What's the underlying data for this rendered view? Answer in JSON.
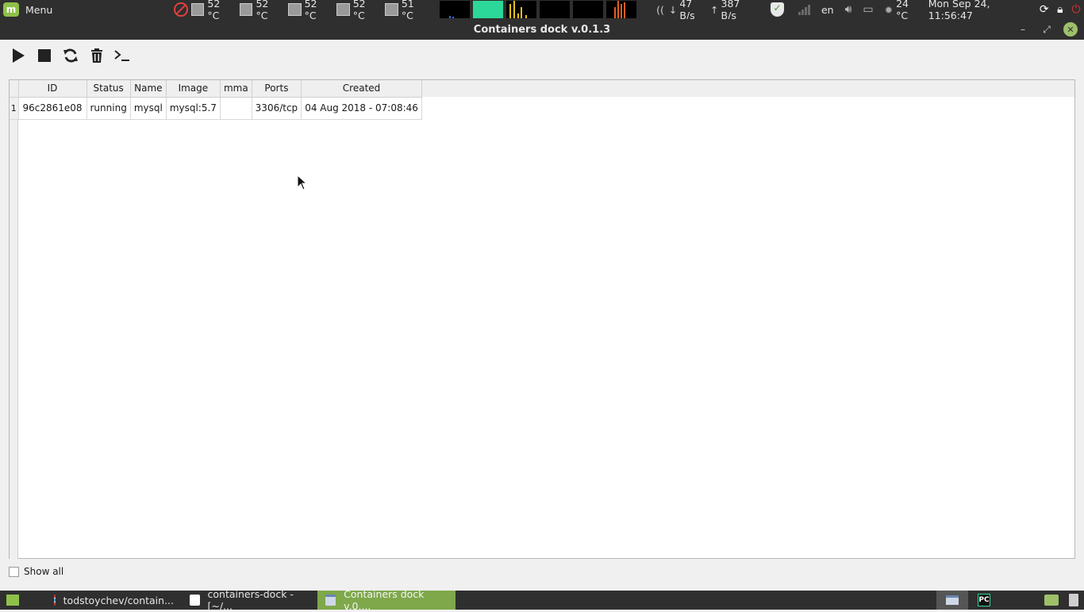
{
  "top_panel": {
    "menu_label": "Menu",
    "temps": [
      "52 °C",
      "52 °C",
      "52 °C",
      "52 °C",
      "51 °C"
    ],
    "net_down": "47 B/s",
    "net_up": "387 B/s",
    "lang": "en",
    "weather_temp": "24 °C",
    "clock": "Mon Sep 24, 11:56:47"
  },
  "window": {
    "title": "Containers dock v.0.1.3"
  },
  "toolbar": {
    "buttons": [
      "play-icon",
      "stop-icon",
      "refresh-icon",
      "trash-icon",
      "terminal-icon"
    ]
  },
  "table": {
    "columns": [
      "ID",
      "Status",
      "Name",
      "Image",
      "mma",
      "Ports",
      "Created"
    ],
    "rows": [
      {
        "num": "1",
        "id": "96c2861e08",
        "status": "running",
        "name": "mysql",
        "image": "mysql:5.7",
        "command": "",
        "ports": "3306/tcp",
        "created": "04 Aug 2018 - 07:08:46"
      }
    ]
  },
  "footer": {
    "show_all_label": "Show all",
    "show_all_checked": false
  },
  "taskbar": {
    "tasks": [
      "todstoychev/contain...",
      "containers-dock - [~/...",
      "Containers dock v.0...."
    ],
    "pycharm_label": "PC"
  },
  "colors": {
    "panel_bg": "#2f2f2f",
    "accent_green": "#8fc04a",
    "active_task": "#7ea84a",
    "window_bg": "#f0f0f0"
  }
}
